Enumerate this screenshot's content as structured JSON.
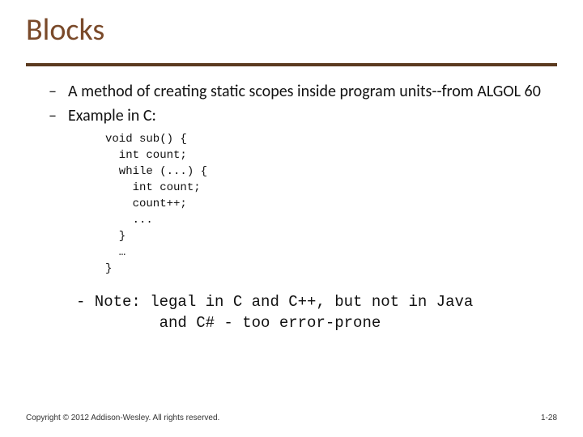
{
  "title": "Blocks",
  "bullets": [
    "A method of creating static scopes inside program units--from ALGOL 60",
    "Example in C:"
  ],
  "code": "void sub() {\n  int count;\n  while (...) {\n    int count;\n    count++;\n    ...\n  }\n  …\n}",
  "note": "- Note: legal in C and C++, but not in Java\n         and C# - too error-prone",
  "footer": {
    "copyright": "Copyright © 2012 Addison-Wesley. All rights reserved.",
    "page": "1-28"
  }
}
